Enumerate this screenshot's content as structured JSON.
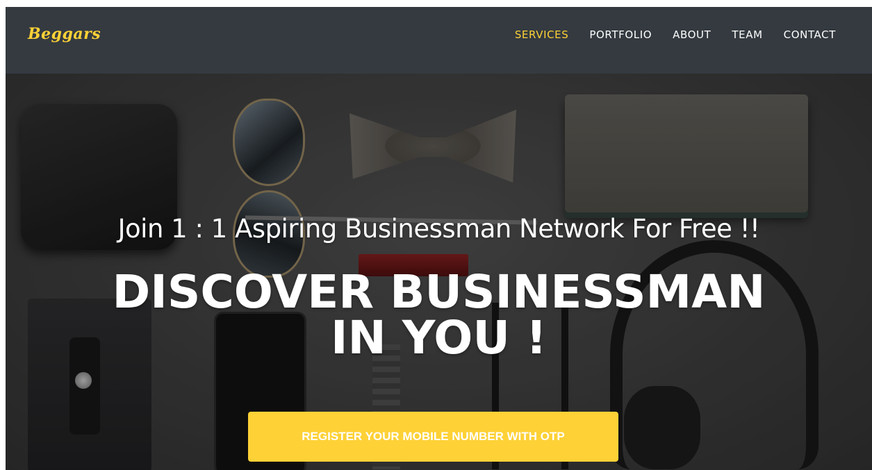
{
  "brand": {
    "name": "Beggars"
  },
  "nav": {
    "items": [
      {
        "label": "SERVICES",
        "active": true
      },
      {
        "label": "PORTFOLIO",
        "active": false
      },
      {
        "label": "ABOUT",
        "active": false
      },
      {
        "label": "TEAM",
        "active": false
      },
      {
        "label": "CONTACT",
        "active": false
      }
    ]
  },
  "hero": {
    "lead": "Join 1 : 1 Aspiring Businessman Network For Free !!",
    "heading_line1": "DISCOVER BUSINESSMAN",
    "heading_line2": "IN YOU !",
    "cta_label": "REGISTER YOUR MOBILE NUMBER WITH OTP",
    "background_image": "flat-lay-accessories-photo"
  },
  "colors": {
    "navbar_bg": "#343a40",
    "accent": "#fed136",
    "text": "#ffffff"
  }
}
